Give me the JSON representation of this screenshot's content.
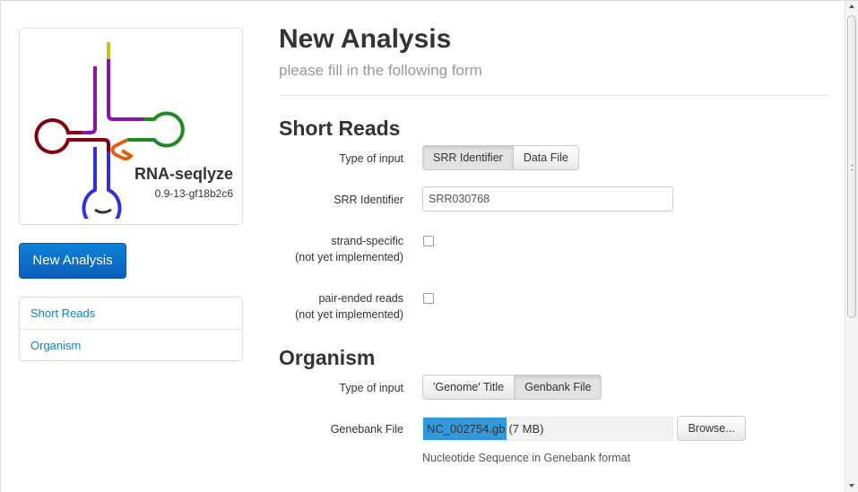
{
  "sidebar": {
    "app_name": "RNA-seqlyze",
    "app_version": "0.9-13-gf18b2c6",
    "new_analysis_button": "New Analysis",
    "nav": [
      {
        "label": "Short Reads"
      },
      {
        "label": "Organism"
      }
    ]
  },
  "main": {
    "title": "New Analysis",
    "subtitle": "please fill in the following form",
    "short_reads": {
      "heading": "Short Reads",
      "type_label": "Type of input",
      "type_options": [
        "SRR Identifier",
        "Data File"
      ],
      "type_selected": "SRR Identifier",
      "srr_label": "SRR Identifier",
      "srr_value": "SRR030768",
      "strand_label": "strand-specific",
      "strand_note": "(not yet implemented)",
      "pair_label": "pair-ended reads",
      "pair_note": "(not yet implemented)"
    },
    "organism": {
      "heading": "Organism",
      "type_label": "Type of input",
      "type_options": [
        "'Genome' Title",
        "Genbank File"
      ],
      "type_selected": "Genbank File",
      "file_label": "Genebank File",
      "file_name": "NC_002754.gb",
      "file_size": "(7 MB)",
      "browse_label": "Browse...",
      "help": "Nucleotide Sequence in Genebank format"
    }
  },
  "colors": {
    "primary_button": "#0a6ac8",
    "link": "#0088cc",
    "logo_yellow": "#c8c020",
    "logo_purple": "#8a14a8",
    "logo_green": "#1f8a24",
    "logo_orange": "#e06010",
    "logo_darkred": "#800010",
    "logo_blue": "#3030e0"
  }
}
